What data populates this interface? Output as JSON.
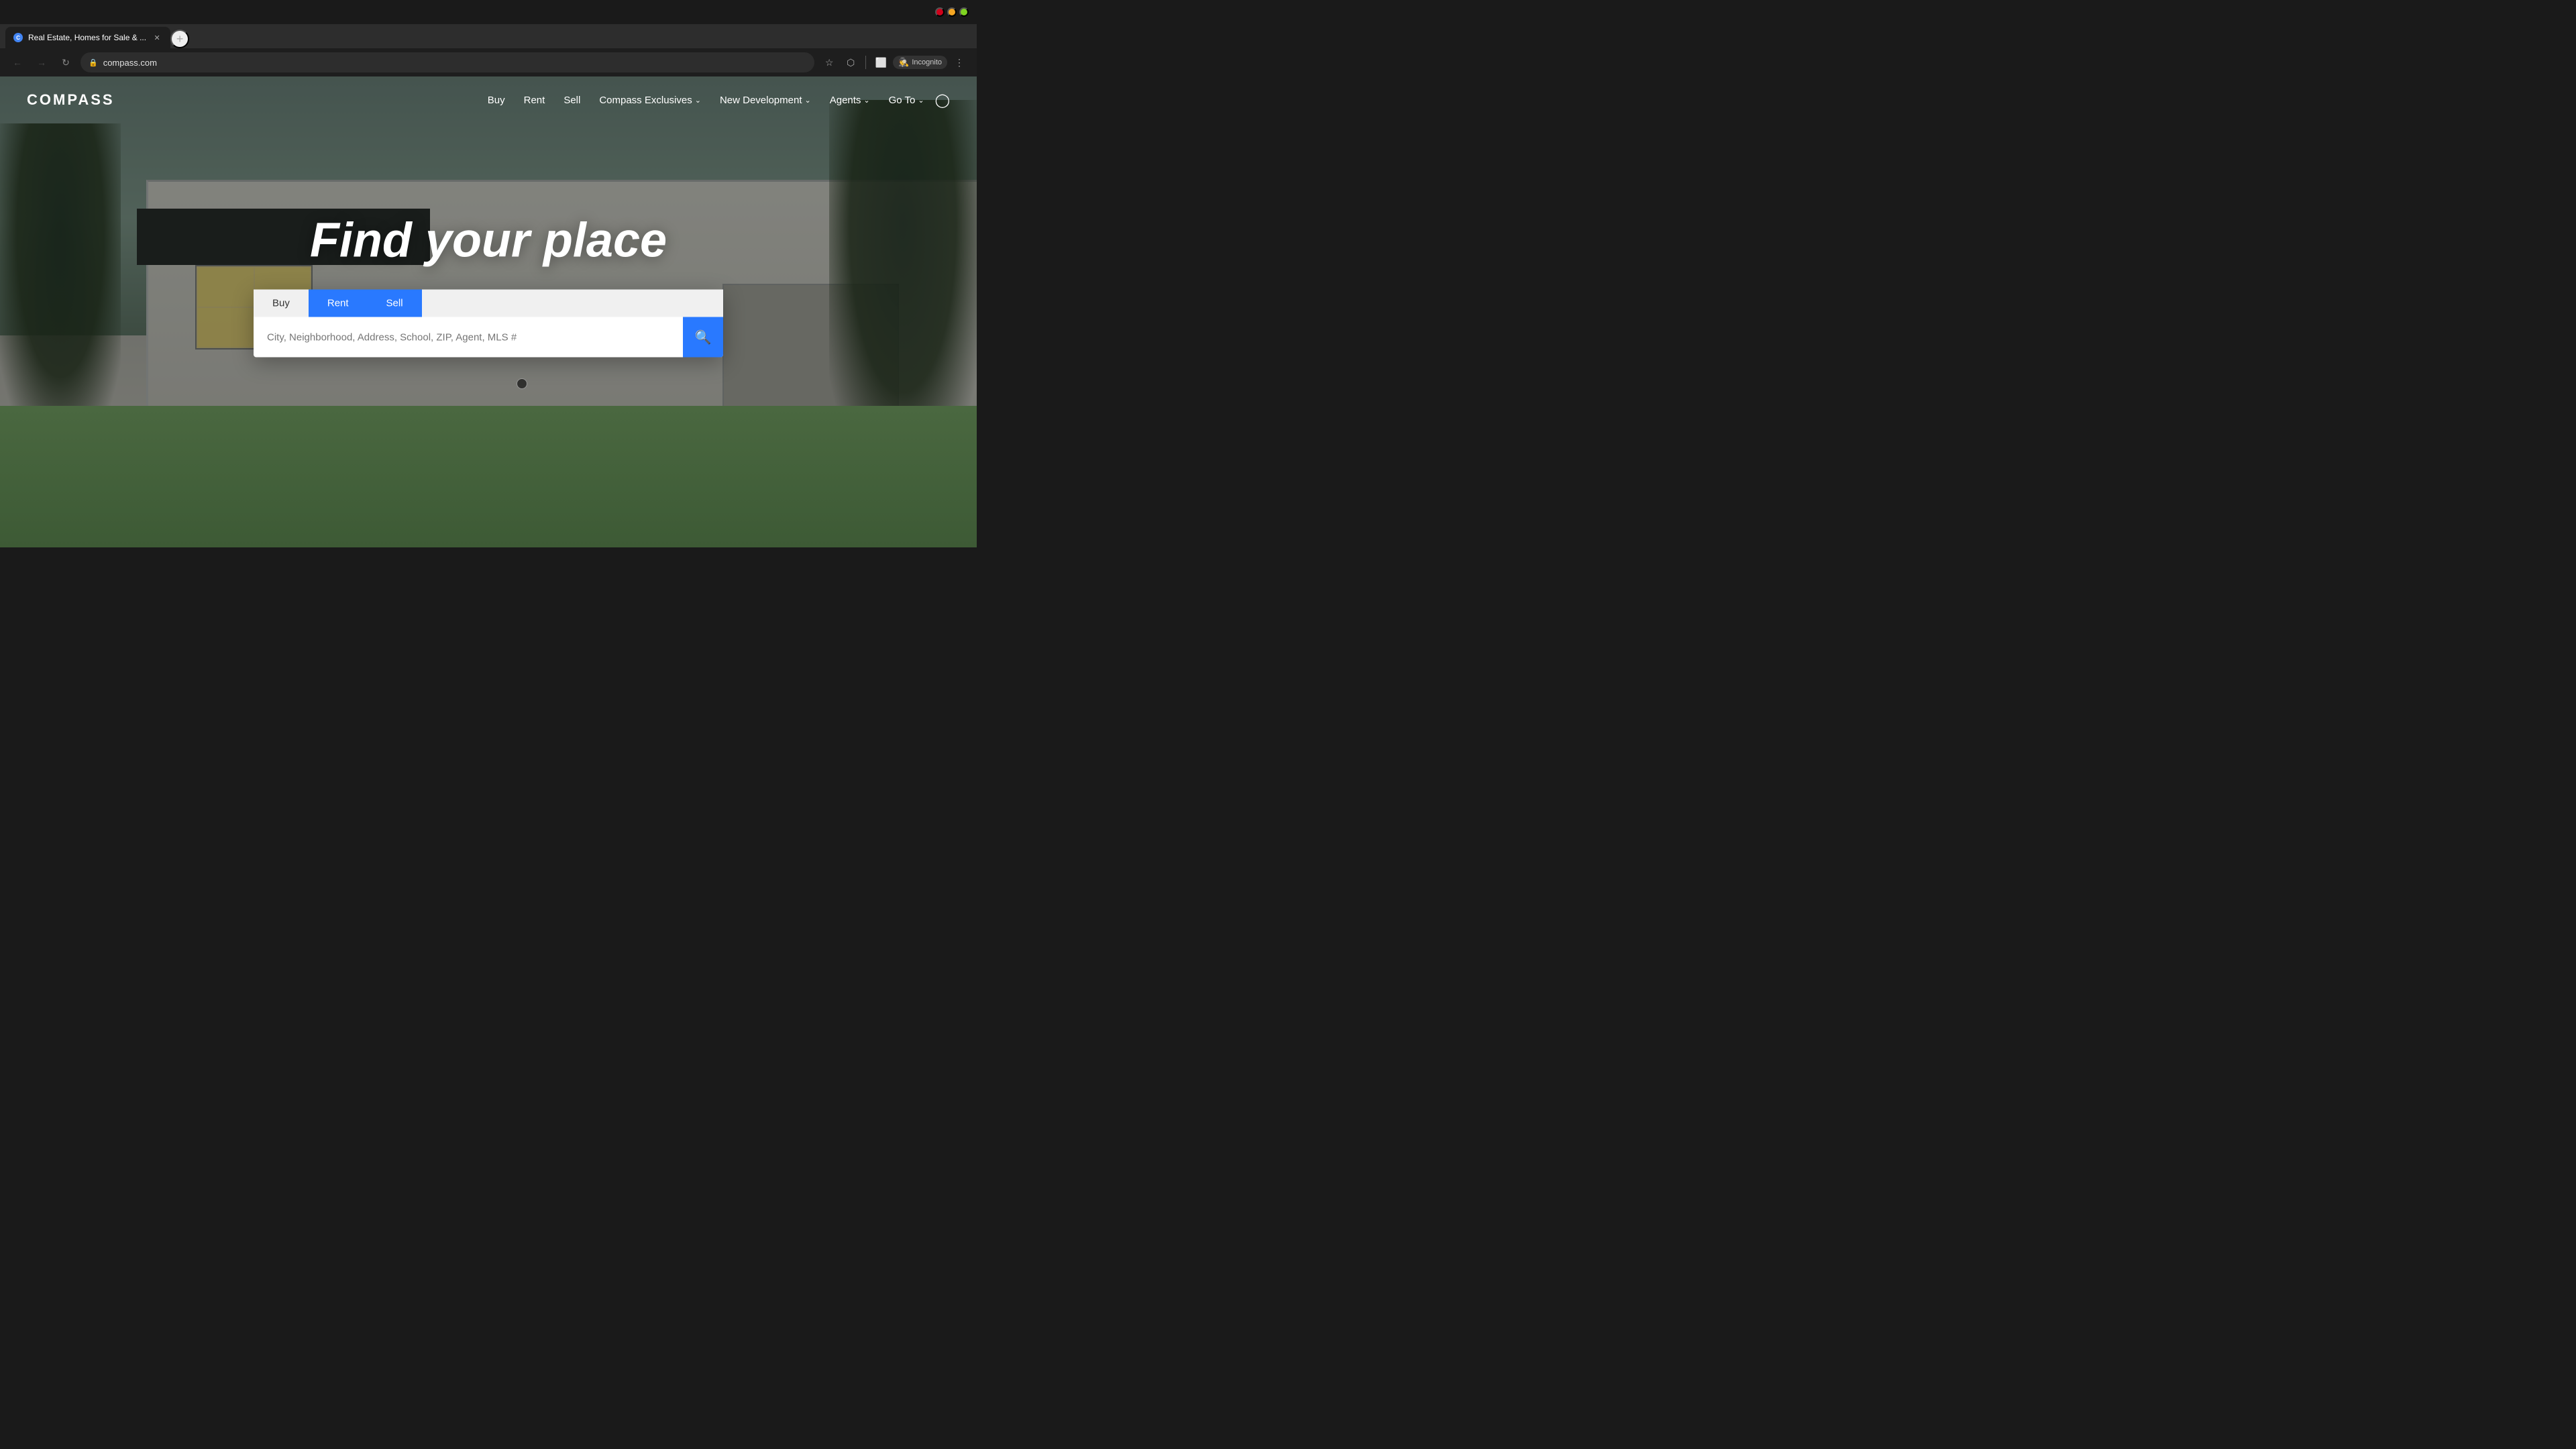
{
  "browser": {
    "tab_title": "Real Estate, Homes for Sale & ...",
    "tab_favicon_label": "C",
    "url": "compass.com",
    "nav_back_disabled": true,
    "nav_forward_disabled": true,
    "incognito_label": "Incognito"
  },
  "nav": {
    "logo": "COMPASS",
    "links": [
      {
        "label": "Buy",
        "has_dropdown": false
      },
      {
        "label": "Rent",
        "has_dropdown": false
      },
      {
        "label": "Sell",
        "has_dropdown": false
      },
      {
        "label": "Compass Exclusives",
        "has_dropdown": true
      },
      {
        "label": "New Development",
        "has_dropdown": true
      },
      {
        "label": "Agents",
        "has_dropdown": true
      },
      {
        "label": "Go To",
        "has_dropdown": true
      }
    ]
  },
  "hero": {
    "title": "Find your place"
  },
  "search": {
    "tabs": [
      {
        "label": "Buy",
        "active": false
      },
      {
        "label": "Rent",
        "active": true
      },
      {
        "label": "Sell",
        "active": true
      }
    ],
    "placeholder": "City, Neighborhood, Address, School, ZIP, Agent, MLS #"
  }
}
